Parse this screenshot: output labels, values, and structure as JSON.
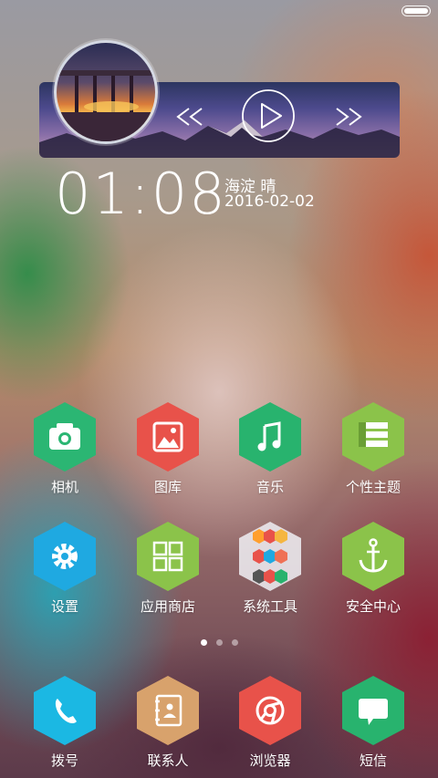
{
  "music_widget": {
    "prev_icon": "rewind-icon",
    "play_icon": "play-icon",
    "next_icon": "fast-forward-icon"
  },
  "clock": {
    "time": "01:08"
  },
  "weather": {
    "location_condition": "海淀  晴",
    "date": "2016-02-02"
  },
  "apps_row1": [
    {
      "label": "相机",
      "icon": "camera-icon",
      "color": "#2bb673"
    },
    {
      "label": "图库",
      "icon": "gallery-icon",
      "color": "#e8524a"
    },
    {
      "label": "音乐",
      "icon": "music-note-icon",
      "color": "#28b36e"
    },
    {
      "label": "个性主题",
      "icon": "theme-layers-icon",
      "color": "#8bc34a"
    }
  ],
  "apps_row2": [
    {
      "label": "设置",
      "icon": "gear-icon",
      "color": "#1fa9e1"
    },
    {
      "label": "应用商店",
      "icon": "app-grid-icon",
      "color": "#8bc34a"
    },
    {
      "label": "系统工具",
      "icon": "folder-icon",
      "color": "#e8e8ec"
    },
    {
      "label": "安全中心",
      "icon": "anchor-icon",
      "color": "#8bc34a"
    }
  ],
  "dock": [
    {
      "label": "拨号",
      "icon": "phone-icon",
      "color": "#1bb8e3"
    },
    {
      "label": "联系人",
      "icon": "contacts-book-icon",
      "color": "#d8a26c"
    },
    {
      "label": "浏览器",
      "icon": "browser-icon",
      "color": "#e8524a"
    },
    {
      "label": "短信",
      "icon": "message-icon",
      "color": "#28b36e"
    }
  ],
  "page_indicator": {
    "count": 3,
    "active": 0
  }
}
